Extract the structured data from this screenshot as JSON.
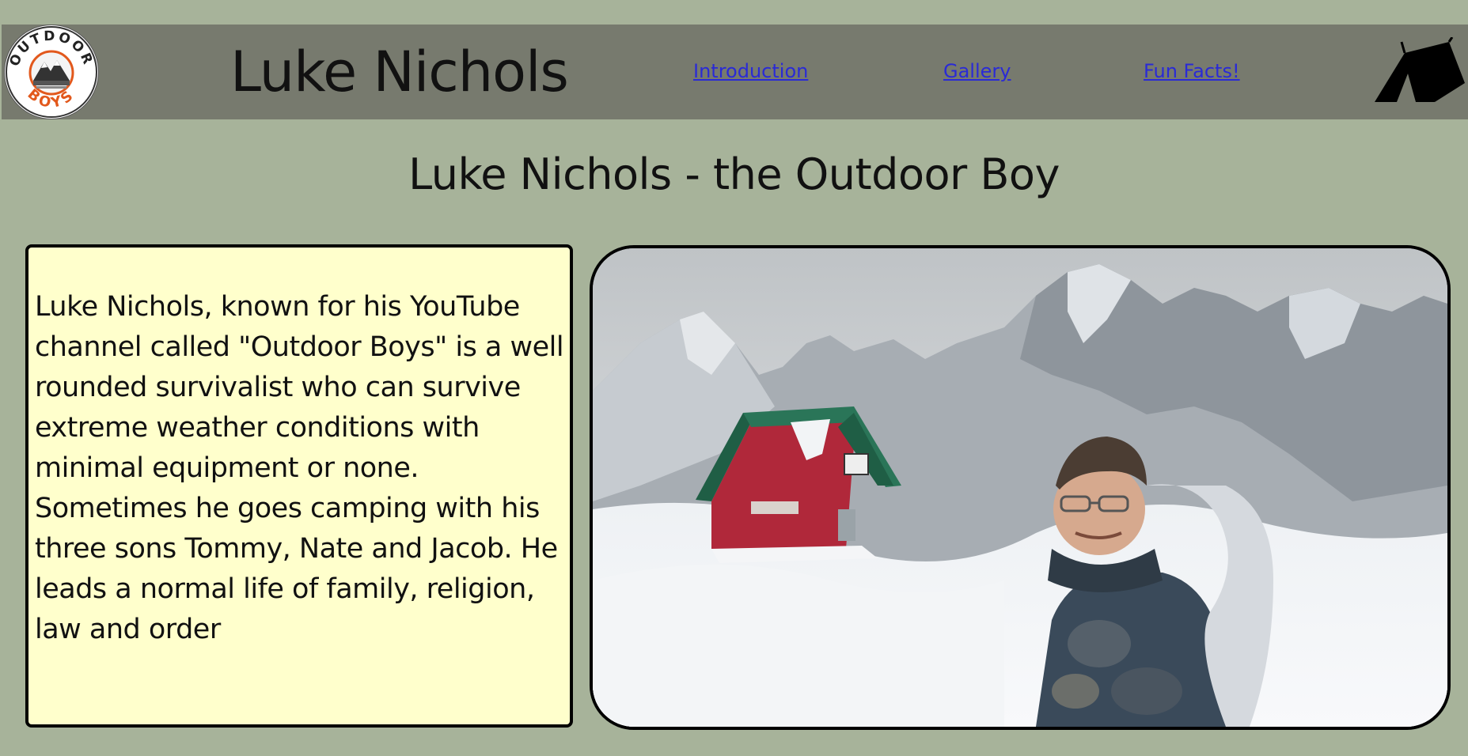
{
  "header": {
    "logo": {
      "icon": "outdoor-boys-logo-icon",
      "text": "OUTDOOR BOYS"
    },
    "site_title": "Luke Nichols",
    "nav": [
      {
        "label": "Introduction"
      },
      {
        "label": "Gallery"
      },
      {
        "label": "Fun Facts!"
      }
    ],
    "tent_icon": "tent-icon"
  },
  "main": {
    "page_title": "Luke Nichols - the Outdoor Boy",
    "intro_text": "Luke Nichols, known for his YouTube channel called \"Outdoor Boys\" is a well rounded survivalist who can survive extreme weather conditions with minimal equipment or none. Sometimes he goes camping with his three sons Tommy, Nate and Jacob. He leads a normal life of family, religion, law and order",
    "photo": {
      "description_icon": "mountain-cabin-photo"
    }
  },
  "colors": {
    "background": "#a7b39a",
    "header": "#777a6e",
    "intro_box": "#ffffcc",
    "link": "#2a2ad6"
  }
}
